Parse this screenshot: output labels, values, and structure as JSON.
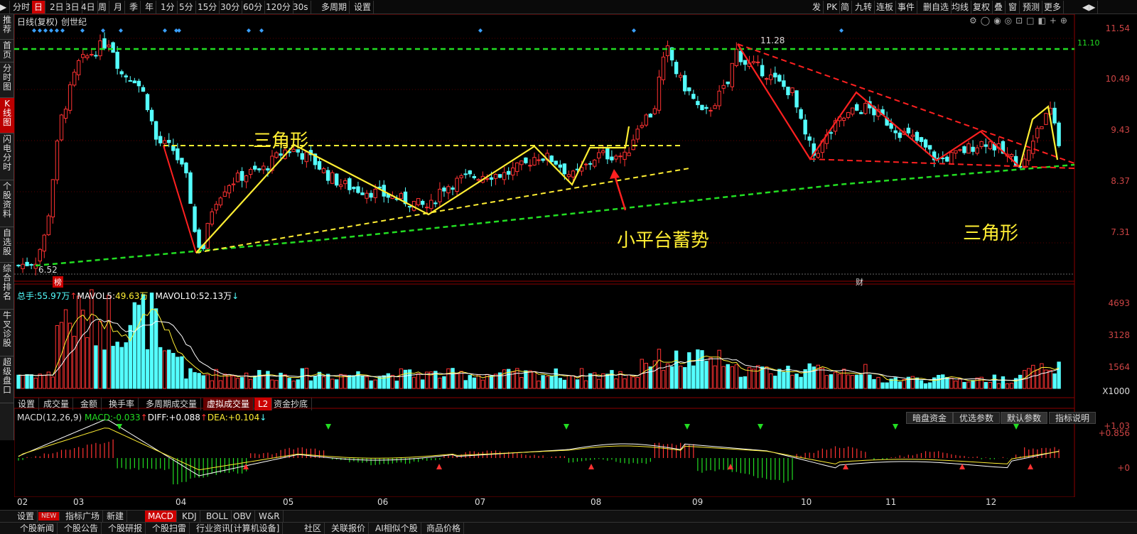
{
  "toolbar": {
    "left": [
      "分时",
      "日",
      "2日",
      "3日",
      "4日",
      "周",
      "月",
      "季",
      "年",
      "1分",
      "5分",
      "15分",
      "30分",
      "60分",
      "120分",
      "30s",
      "多周期",
      "设置"
    ],
    "active_index": 1,
    "right": [
      "发",
      "PK",
      "简",
      "九转",
      "连板",
      "事件",
      "删自选",
      "均线",
      "复权",
      "叠",
      "窗",
      "预测",
      "更多"
    ]
  },
  "sidebar": [
    "推荐",
    "首页",
    "分时图",
    "K线图",
    "闪电分时",
    "个股资料",
    "自选股",
    "综合排名",
    "牛叉诊股",
    "超级盘口"
  ],
  "sidebar_active": 3,
  "chart_header": {
    "mode": "日线(复权)",
    "stock": "创世纪"
  },
  "price_axis": [
    "11.54",
    "10.49",
    "9.43",
    "8.37",
    "7.31"
  ],
  "price_marks": {
    "high": "11.28",
    "low": "6.52",
    "level": "11.10"
  },
  "volume_axis": [
    "4693",
    "3128",
    "1564",
    "X1000"
  ],
  "volume_header": {
    "total_label": "总手:",
    "total": "55.97万",
    "mavol5_label": "MAVOL5:",
    "mavol5": "49.63万",
    "mavol10_label": "MAVOL10:",
    "mavol10": "52.13万"
  },
  "indicator_tabs": [
    "设置",
    "成交量",
    "金额",
    "换手率",
    "多周期成交量",
    "虚拟成交量",
    "L2",
    "资金抄底"
  ],
  "macd_header": {
    "name": "MACD(12,26,9)",
    "macd_label": "MACD:",
    "macd": "-0.033",
    "diff_label": "DIFF:",
    "diff": "+0.088",
    "dea_label": "DEA:",
    "dea": "+0.104"
  },
  "macd_axis": [
    "+1.03",
    "+0.856",
    "+0"
  ],
  "macd_buttons": [
    "暗盘资金",
    "优选参数",
    "默认参数",
    "指标说明"
  ],
  "months": [
    "02",
    "03",
    "04",
    "05",
    "06",
    "07",
    "08",
    "09",
    "10",
    "11",
    "12"
  ],
  "badges": {
    "bang": "榜",
    "cai": "财"
  },
  "annotations": {
    "triangle1": "三角形",
    "platform": "小平台蓄势",
    "triangle2": "三角形"
  },
  "bottom_tabs": [
    "设置",
    "NEW",
    "指标广场",
    "新建",
    "MACD",
    "KDJ",
    "BOLL",
    "OBV",
    "W&R"
  ],
  "bottom_active": 4,
  "news_tabs": [
    "个股新闻",
    "个股公告",
    "个股研报",
    "个股扫雷",
    "行业资讯[计算机设备]",
    "社区",
    "关联报价",
    "AI相似个股",
    "商品价格"
  ],
  "colors": {
    "up": "#ff3232",
    "down": "#54ffff",
    "ma_yellow": "#ffee33",
    "green_dash": "#22dd22",
    "red_trend": "#ff2020"
  }
}
